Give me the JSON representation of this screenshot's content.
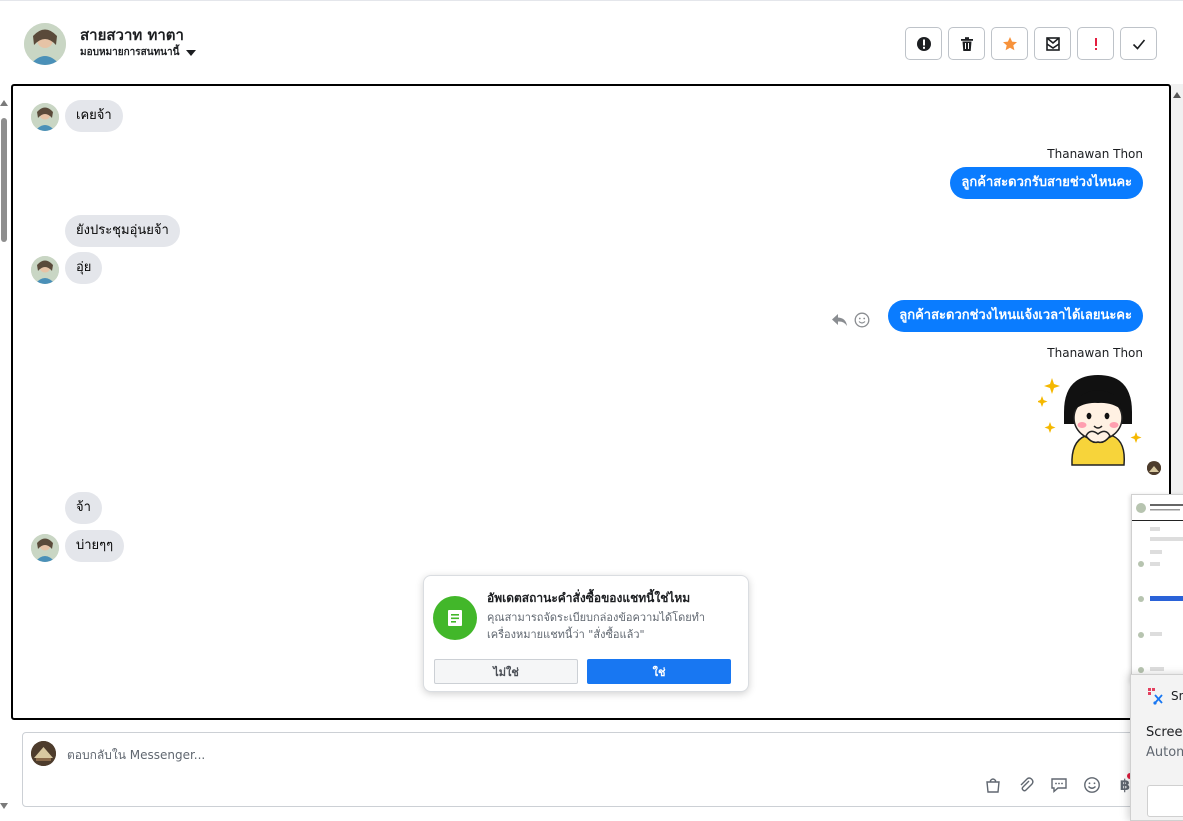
{
  "header": {
    "contact_name": "สายสวาท ทาตา",
    "assign_label": "มอบหมายการสนทนานี้",
    "actions": [
      {
        "name": "spam-button",
        "icon": "exclamation-circle-icon"
      },
      {
        "name": "delete-button",
        "icon": "trash-icon"
      },
      {
        "name": "star-button",
        "icon": "star-icon",
        "color": "#f7923b"
      },
      {
        "name": "mark-unread-button",
        "icon": "envelope-icon"
      },
      {
        "name": "follow-up-button",
        "icon": "exclamation-icon",
        "color": "#e41e3f"
      },
      {
        "name": "mark-done-button",
        "icon": "checkmark-icon"
      }
    ]
  },
  "messages": {
    "m1": "เคยจ้า",
    "sender1": "Thanawan Thon",
    "m2": "ลูกค้าสะดวกรับสายช่วงไหนคะ",
    "m3": "ยังประชุมอุ่นยจ้า",
    "m4": "อุ่ย",
    "m5": "ลูกค้าสะดวกช่วงไหนแจ้งเวลาได้เลยนะคะ",
    "sender2": "Thanawan Thon",
    "m6": "จ้า",
    "m7": "บ่ายๆๆ"
  },
  "popup": {
    "title": "อัพเดตสถานะคำสั่งซื้อของแชทนี้ใช่ไหม",
    "body": "คุณสามารถจัดระเบียบกล่องข้อความได้โดยทำเครื่องหมายแชทนี้ว่า \"สั่งซื้อแล้ว\"",
    "no_label": "ไม่ใช่",
    "yes_label": "ใช่"
  },
  "composer": {
    "placeholder": "ตอบกลับใน Messenger...",
    "currency_symbol": "฿",
    "tools": [
      "shopping-bag-icon",
      "paperclip-icon",
      "saved-reply-icon",
      "emoji-icon",
      "baht-icon"
    ]
  },
  "snip": {
    "title": "Sn",
    "line1": "Screer",
    "line2": "Autom"
  },
  "colors": {
    "outgoing_bubble": "#0a7cff",
    "incoming_bubble": "#e4e6eb",
    "primary_button": "#1877f2",
    "popup_icon": "#42b72a"
  }
}
